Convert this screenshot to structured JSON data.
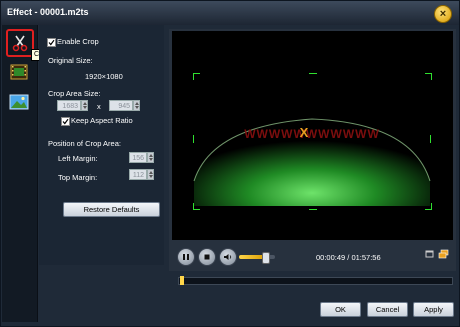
{
  "window": {
    "title": "Effect - 00001.m2ts"
  },
  "toolbar": {
    "crop_tooltip": "Crop"
  },
  "crop": {
    "enable_label": "Enable Crop",
    "enabled": true,
    "original_size_label": "Original Size:",
    "original_size": "1920×1080",
    "area_size_label": "Crop Area Size:",
    "width": "1683",
    "times": "x",
    "height": "945",
    "keep_aspect_label": "Keep Aspect Ratio",
    "keep_aspect": true,
    "position_label": "Position of Crop Area:",
    "left_margin_label": "Left Margin:",
    "left_margin": "156",
    "top_margin_label": "Top Margin:",
    "top_margin": "112",
    "restore_label": "Restore Defaults"
  },
  "player": {
    "time": "00:00:49 / 01:57:56",
    "volume": 0.75,
    "progress": 0.007
  },
  "footer": {
    "ok": "OK",
    "cancel": "Cancel",
    "apply": "Apply"
  },
  "colors": {
    "accent": "#2fe02f",
    "highlight": "#e02020",
    "volume": "#ffd64a"
  }
}
